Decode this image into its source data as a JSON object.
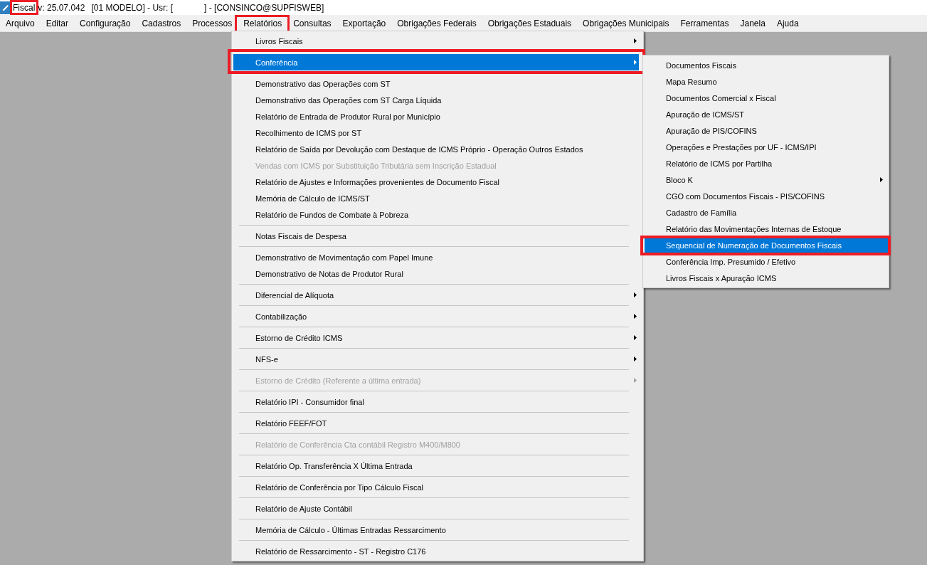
{
  "title_bar": {
    "app_name": "Fiscal",
    "app_name_callout": true,
    "version": "v: 25.07.042",
    "session": "[01 MODELO] - Usr: [",
    "connection": "] - [CONSINCO@SUPFISWEB]"
  },
  "menu_bar": [
    {
      "label": "Arquivo",
      "callout": false
    },
    {
      "label": "Editar",
      "callout": false
    },
    {
      "label": "Configuração",
      "callout": false
    },
    {
      "label": "Cadastros",
      "callout": false
    },
    {
      "label": "Processos",
      "callout": false
    },
    {
      "label": "Relatórios",
      "callout": true
    },
    {
      "label": "Consultas",
      "callout": false
    },
    {
      "label": "Exportação",
      "callout": false
    },
    {
      "label": "Obrigações Federais",
      "callout": false
    },
    {
      "label": "Obrigações Estaduais",
      "callout": false
    },
    {
      "label": "Obrigações Municipais",
      "callout": false
    },
    {
      "label": "Ferramentas",
      "callout": false
    },
    {
      "label": "Janela",
      "callout": false
    },
    {
      "label": "Ajuda",
      "callout": false
    }
  ],
  "dropdown": {
    "groups": [
      {
        "items": [
          {
            "label": "Livros Fiscais",
            "selected": false,
            "disabled": false,
            "has_submenu": true,
            "callout": false
          }
        ]
      },
      {
        "items": [
          {
            "label": "Conferência",
            "selected": true,
            "disabled": false,
            "has_submenu": true,
            "callout": true,
            "children": [
              {
                "label": "Documentos Fiscais",
                "selected": false,
                "has_submenu": false,
                "callout": false
              },
              {
                "label": "Mapa Resumo",
                "selected": false,
                "has_submenu": false,
                "callout": false
              },
              {
                "label": "Documentos Comercial x Fiscal",
                "selected": false,
                "has_submenu": false,
                "callout": false
              },
              {
                "label": "Apuração de ICMS/ST",
                "selected": false,
                "has_submenu": false,
                "callout": false
              },
              {
                "label": "Apuração de PIS/COFINS",
                "selected": false,
                "has_submenu": false,
                "callout": false
              },
              {
                "label": "Operações e Prestações por UF - ICMS/IPI",
                "selected": false,
                "has_submenu": false,
                "callout": false
              },
              {
                "label": "Relatório de ICMS por Partilha",
                "selected": false,
                "has_submenu": false,
                "callout": false
              },
              {
                "label": "Bloco K",
                "selected": false,
                "has_submenu": true,
                "callout": false
              },
              {
                "label": "CGO com Documentos Fiscais - PIS/COFINS",
                "selected": false,
                "has_submenu": false,
                "callout": false
              },
              {
                "label": "Cadastro de Família",
                "selected": false,
                "has_submenu": false,
                "callout": false
              },
              {
                "label": "Relatório das Movimentações Internas de Estoque",
                "selected": false,
                "has_submenu": false,
                "callout": false
              },
              {
                "label": "Sequencial de Numeração de Documentos Fiscais",
                "selected": true,
                "has_submenu": false,
                "callout": true
              },
              {
                "label": "Conferência Imp. Presumido / Efetivo",
                "selected": false,
                "has_submenu": false,
                "callout": false
              },
              {
                "label": "Livros Fiscais x Apuração ICMS",
                "selected": false,
                "has_submenu": false,
                "callout": false
              }
            ]
          }
        ]
      },
      {
        "items": [
          {
            "label": "Demonstrativo das Operações com ST",
            "selected": false,
            "disabled": false,
            "has_submenu": false,
            "callout": false
          },
          {
            "label": "Demonstrativo das Operações com ST Carga Líquida",
            "selected": false,
            "disabled": false,
            "has_submenu": false,
            "callout": false
          },
          {
            "label": "Relatório de Entrada de Produtor Rural por Município",
            "selected": false,
            "disabled": false,
            "has_submenu": false,
            "callout": false
          },
          {
            "label": "Recolhimento de ICMS por ST",
            "selected": false,
            "disabled": false,
            "has_submenu": false,
            "callout": false
          },
          {
            "label": "Relatório de Saída por Devolução com Destaque de ICMS Próprio - Operação Outros Estados",
            "selected": false,
            "disabled": false,
            "has_submenu": false,
            "callout": false
          },
          {
            "label": "Vendas com ICMS por Substituição Tributária sem Inscrição Estadual",
            "selected": false,
            "disabled": true,
            "has_submenu": false,
            "callout": false
          },
          {
            "label": "Relatório de Ajustes e Informações provenientes de Documento Fiscal",
            "selected": false,
            "disabled": false,
            "has_submenu": false,
            "callout": false
          },
          {
            "label": "Memória de Cálculo de ICMS/ST",
            "selected": false,
            "disabled": false,
            "has_submenu": false,
            "callout": false
          },
          {
            "label": "Relatório de Fundos de Combate à Pobreza",
            "selected": false,
            "disabled": false,
            "has_submenu": false,
            "callout": false
          }
        ]
      },
      {
        "items": [
          {
            "label": "Notas Fiscais de Despesa",
            "selected": false,
            "disabled": false,
            "has_submenu": false,
            "callout": false
          }
        ]
      },
      {
        "items": [
          {
            "label": "Demonstrativo de Movimentação com Papel Imune",
            "selected": false,
            "disabled": false,
            "has_submenu": false,
            "callout": false
          },
          {
            "label": "Demonstrativo de Notas de Produtor Rural",
            "selected": false,
            "disabled": false,
            "has_submenu": false,
            "callout": false
          }
        ]
      },
      {
        "items": [
          {
            "label": "Diferencial de Alíquota",
            "selected": false,
            "disabled": false,
            "has_submenu": true,
            "callout": false
          }
        ]
      },
      {
        "items": [
          {
            "label": "Contabilização",
            "selected": false,
            "disabled": false,
            "has_submenu": true,
            "callout": false
          }
        ]
      },
      {
        "items": [
          {
            "label": "Estorno de Crédito ICMS",
            "selected": false,
            "disabled": false,
            "has_submenu": true,
            "callout": false
          }
        ]
      },
      {
        "items": [
          {
            "label": "NFS-e",
            "selected": false,
            "disabled": false,
            "has_submenu": true,
            "callout": false
          }
        ]
      },
      {
        "items": [
          {
            "label": "Estorno de Crédito (Referente a última entrada)",
            "selected": false,
            "disabled": true,
            "has_submenu": true,
            "callout": false
          }
        ]
      },
      {
        "items": [
          {
            "label": "Relatório IPI - Consumidor final",
            "selected": false,
            "disabled": false,
            "has_submenu": false,
            "callout": false
          }
        ]
      },
      {
        "items": [
          {
            "label": "Relatório FEEF/FOT",
            "selected": false,
            "disabled": false,
            "has_submenu": false,
            "callout": false
          }
        ]
      },
      {
        "items": [
          {
            "label": "Relatório de Conferência Cta contábil Registro M400/M800",
            "selected": false,
            "disabled": true,
            "has_submenu": false,
            "callout": false
          }
        ]
      },
      {
        "items": [
          {
            "label": "Relatório Op. Transferência X Última Entrada",
            "selected": false,
            "disabled": false,
            "has_submenu": false,
            "callout": false
          }
        ]
      },
      {
        "items": [
          {
            "label": "Relatório de Conferência por Tipo Cálculo Fiscal",
            "selected": false,
            "disabled": false,
            "has_submenu": false,
            "callout": false
          }
        ]
      },
      {
        "items": [
          {
            "label": "Relatório de Ajuste Contábil",
            "selected": false,
            "disabled": false,
            "has_submenu": false,
            "callout": false
          }
        ]
      },
      {
        "items": [
          {
            "label": "Memória de Cálculo - Últimas Entradas Ressarcimento",
            "selected": false,
            "disabled": false,
            "has_submenu": false,
            "callout": false
          }
        ]
      },
      {
        "items": [
          {
            "label": "Relatório de Ressarcimento - ST - Registro C176",
            "selected": false,
            "disabled": false,
            "has_submenu": false,
            "callout": false
          }
        ]
      }
    ]
  }
}
